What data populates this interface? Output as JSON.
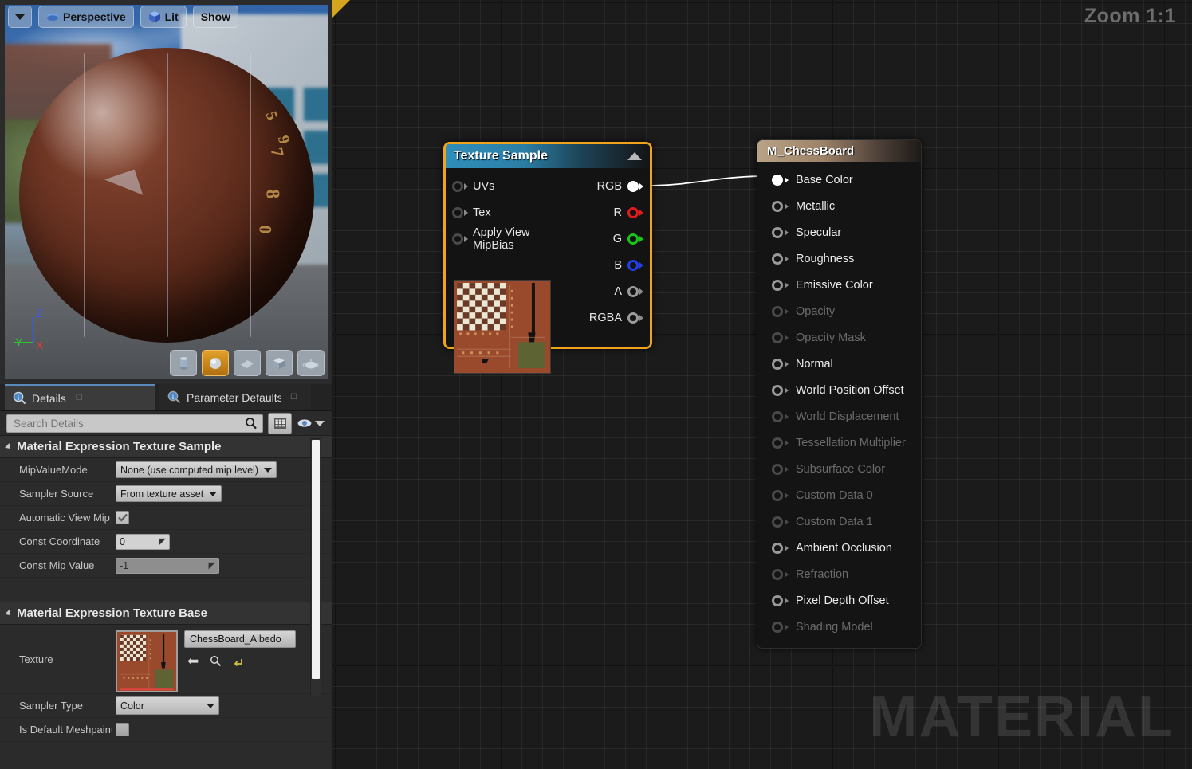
{
  "viewport": {
    "toolbar": {
      "dropdown_icon": "chevron-down-icon",
      "view_mode": "Perspective",
      "view_mode_icon": "camera-icon",
      "lighting": "Lit",
      "lighting_icon": "cube-icon",
      "show": "Show"
    },
    "gizmo": {
      "x": "X",
      "y": "Y",
      "z": "Z",
      "x_color": "#e03a3a",
      "y_color": "#2fc42f",
      "z_color": "#3a5ae0"
    },
    "shapes": [
      {
        "name": "cylinder",
        "label": "Cylinder",
        "selected": false
      },
      {
        "name": "sphere",
        "label": "Sphere",
        "selected": true
      },
      {
        "name": "plane",
        "label": "Plane",
        "selected": false
      },
      {
        "name": "cube",
        "label": "Cube",
        "selected": false
      },
      {
        "name": "teapot",
        "label": "Teapot",
        "selected": false
      }
    ],
    "sphere_digits": [
      "5",
      "7",
      "8",
      "9",
      "0"
    ]
  },
  "details": {
    "tabs": [
      {
        "label": "Details",
        "icon": "info-magnifier-icon",
        "active": true
      },
      {
        "label": "Parameter Defaults",
        "icon": "info-magnifier-icon",
        "active": false
      }
    ],
    "search": {
      "placeholder": "Search Details",
      "value": "",
      "icon": "search-icon"
    },
    "grid_view_icon": "grid-view-icon",
    "eye_icon": "eye-icon",
    "sections": [
      {
        "title": "Material Expression Texture Sample",
        "rows": [
          {
            "label": "MipValueMode",
            "type": "combo",
            "value": "None (use computed mip level)"
          },
          {
            "label": "Sampler Source",
            "type": "combo",
            "value": "From texture asset"
          },
          {
            "label": "Automatic View Mip",
            "type": "checkbox",
            "value": "checked"
          },
          {
            "label": "Const Coordinate",
            "type": "number",
            "value": "0",
            "dim": false
          },
          {
            "label": "Const Mip Value",
            "type": "number",
            "value": "-1",
            "dim": true
          }
        ]
      },
      {
        "title": "Material Expression Texture Base",
        "rows": [
          {
            "label": "Texture",
            "type": "asset",
            "value": "ChessBoard_Albedo"
          },
          {
            "label": "Sampler Type",
            "type": "combo",
            "value": "Color"
          },
          {
            "label": "Is Default Meshpaint",
            "type": "checkbox",
            "value": "unchecked"
          }
        ]
      }
    ],
    "asset_actions": [
      {
        "name": "use-selected-asset-icon",
        "glyph": "←"
      },
      {
        "name": "browse-to-asset-icon",
        "glyph": "search"
      },
      {
        "name": "reset-to-default-icon",
        "glyph": "reset"
      }
    ]
  },
  "graph": {
    "zoom_label": "Zoom 1:1",
    "watermark": "MATERIAL",
    "corner_marker": "dirty-flag-triangle",
    "texture_sample_node": {
      "title": "Texture Sample",
      "collapse_icon": "chevron-up-icon",
      "selected": true,
      "inputs": [
        {
          "label": "UVs",
          "connected": false
        },
        {
          "label": "Tex",
          "connected": false
        },
        {
          "label": "Apply View MipBias",
          "connected": false
        }
      ],
      "outputs": [
        {
          "label": "RGB",
          "color": "#ffffff",
          "connected": true
        },
        {
          "label": "R",
          "color": "#e01b1b",
          "connected": false
        },
        {
          "label": "G",
          "color": "#18c418",
          "connected": false
        },
        {
          "label": "B",
          "color": "#2240e6",
          "connected": false
        },
        {
          "label": "A",
          "color": "#9a9a9a",
          "connected": false
        },
        {
          "label": "RGBA",
          "color": "#9a9a9a",
          "connected": false
        }
      ]
    },
    "material_node": {
      "title": "M_ChessBoard",
      "pins": [
        {
          "label": "Base Color",
          "enabled": true,
          "connected": true
        },
        {
          "label": "Metallic",
          "enabled": true,
          "connected": false
        },
        {
          "label": "Specular",
          "enabled": true,
          "connected": false
        },
        {
          "label": "Roughness",
          "enabled": true,
          "connected": false
        },
        {
          "label": "Emissive Color",
          "enabled": true,
          "connected": false
        },
        {
          "label": "Opacity",
          "enabled": false,
          "connected": false
        },
        {
          "label": "Opacity Mask",
          "enabled": false,
          "connected": false
        },
        {
          "label": "Normal",
          "enabled": true,
          "connected": false
        },
        {
          "label": "World Position Offset",
          "enabled": true,
          "connected": false
        },
        {
          "label": "World Displacement",
          "enabled": false,
          "connected": false
        },
        {
          "label": "Tessellation Multiplier",
          "enabled": false,
          "connected": false
        },
        {
          "label": "Subsurface Color",
          "enabled": false,
          "connected": false
        },
        {
          "label": "Custom Data 0",
          "enabled": false,
          "connected": false
        },
        {
          "label": "Custom Data 1",
          "enabled": false,
          "connected": false
        },
        {
          "label": "Ambient Occlusion",
          "enabled": true,
          "connected": false
        },
        {
          "label": "Refraction",
          "enabled": false,
          "connected": false
        },
        {
          "label": "Pixel Depth Offset",
          "enabled": true,
          "connected": false
        },
        {
          "label": "Shading Model",
          "enabled": false,
          "connected": false
        }
      ]
    },
    "colors": {
      "accent_selected": "#f0a31b",
      "node_header_expression": "#2f8fba",
      "node_header_material": "#b9a387",
      "wire": "#ffffff",
      "background": "#1b1b1b"
    }
  }
}
